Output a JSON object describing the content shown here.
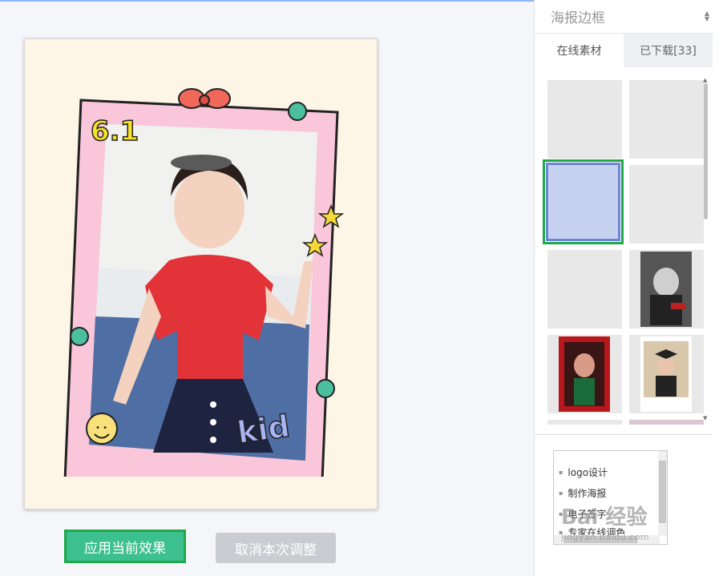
{
  "panel": {
    "dropdown_label": "海报边框",
    "tabs": [
      {
        "label": "在线素材"
      },
      {
        "label": "已下载[33]"
      }
    ]
  },
  "preview": {
    "frame_text_top": "6.1",
    "frame_text_bottom": "kid"
  },
  "actions": {
    "apply_label": "应用当前效果",
    "cancel_label": "取消本次调整"
  },
  "side_list": {
    "items": [
      "logo设计",
      "制作海报",
      "电子签字",
      "专家在线调色"
    ]
  },
  "watermark": {
    "brand": "Bai 经验",
    "url": "jingyan.baidu.com"
  },
  "colors": {
    "accent_green": "#22a84a",
    "apply_fill": "#3cc08f",
    "cancel_fill": "#c9ccd1",
    "frame_pink": "#f9c6da",
    "selected_thumb": "#c7d2f1"
  }
}
